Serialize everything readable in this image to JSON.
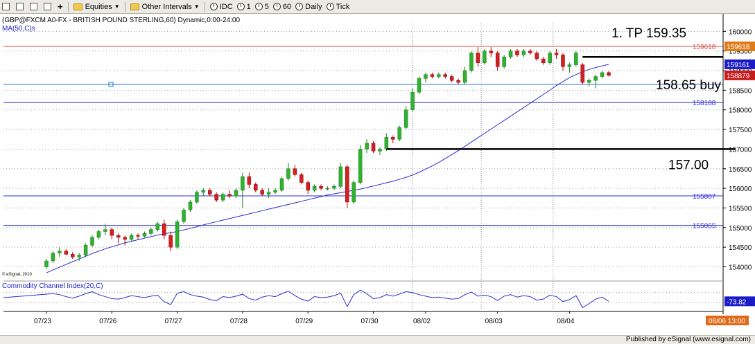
{
  "toolbar": {
    "equities": "Equities",
    "other_intervals": "Other Intervals",
    "intervals": [
      "IDC",
      "1",
      "5",
      "60",
      "Daily",
      "Tick"
    ]
  },
  "chart_data": {
    "type": "candlestick",
    "title": "(GBP@FXCM A0-FX - BRITISH POUND STERLING,60) Dynamic,0:00-24:00",
    "ma_label": "MA(50,C)s",
    "watermark": "© eSignal, 2010",
    "x_ticks": [
      "07/23",
      "07/26",
      "07/27",
      "07/28",
      "07/29",
      "07/30",
      "08/02",
      "08/03",
      "08/04"
    ],
    "y_ticks": [
      "160000",
      "159500",
      "159000",
      "158500",
      "158000",
      "157500",
      "157000",
      "156500",
      "156000",
      "155500",
      "155000",
      "154500",
      "154000"
    ],
    "ylim": [
      153850,
      160200
    ],
    "candles": [
      [
        154000,
        154200,
        153950,
        154150
      ],
      [
        154150,
        154400,
        154100,
        154350
      ],
      [
        154350,
        154500,
        154250,
        154400
      ],
      [
        154400,
        154450,
        154300,
        154320
      ],
      [
        154320,
        154380,
        154200,
        154250
      ],
      [
        154250,
        154350,
        154150,
        154300
      ],
      [
        154300,
        154600,
        154250,
        154550
      ],
      [
        154550,
        154800,
        154500,
        154750
      ],
      [
        154750,
        154950,
        154700,
        154900
      ],
      [
        154900,
        155100,
        154800,
        154950
      ],
      [
        154950,
        155000,
        154700,
        154800
      ],
      [
        154800,
        154850,
        154600,
        154750
      ],
      [
        154750,
        154800,
        154550,
        154700
      ],
      [
        154700,
        154850,
        154650,
        154800
      ],
      [
        154800,
        154850,
        154700,
        154780
      ],
      [
        154780,
        154900,
        154750,
        154850
      ],
      [
        154850,
        155000,
        154800,
        154950
      ],
      [
        154950,
        155150,
        154900,
        155100
      ],
      [
        155100,
        155200,
        154700,
        154800
      ],
      [
        154800,
        154900,
        154400,
        154500
      ],
      [
        154500,
        155200,
        154450,
        155150
      ],
      [
        155150,
        155500,
        155100,
        155450
      ],
      [
        155450,
        155700,
        155400,
        155650
      ],
      [
        155650,
        155950,
        155600,
        155900
      ],
      [
        155900,
        156000,
        155800,
        155950
      ],
      [
        155950,
        156000,
        155800,
        155850
      ],
      [
        155850,
        155900,
        155650,
        155700
      ],
      [
        155700,
        155900,
        155650,
        155850
      ],
      [
        155850,
        155950,
        155750,
        155800
      ],
      [
        155800,
        156000,
        155750,
        155950
      ],
      [
        155950,
        156400,
        155500,
        156300
      ],
      [
        156300,
        156400,
        156000,
        156100
      ],
      [
        156100,
        156150,
        155900,
        155950
      ],
      [
        155950,
        156000,
        155800,
        155850
      ],
      [
        155850,
        156000,
        155750,
        155900
      ],
      [
        155900,
        156000,
        155850,
        155950
      ],
      [
        155950,
        156300,
        155900,
        156250
      ],
      [
        156250,
        156650,
        156200,
        156500
      ],
      [
        156500,
        156600,
        156300,
        156350
      ],
      [
        156350,
        156400,
        156100,
        156150
      ],
      [
        156150,
        156200,
        155850,
        155950
      ],
      [
        155950,
        156100,
        155900,
        156050
      ],
      [
        156050,
        156100,
        155950,
        156000
      ],
      [
        156000,
        156050,
        155950,
        156000
      ],
      [
        156000,
        156100,
        155950,
        156050
      ],
      [
        156050,
        156650,
        156000,
        156550
      ],
      [
        156550,
        156600,
        155500,
        155650
      ],
      [
        155650,
        156200,
        155600,
        156150
      ],
      [
        156150,
        157100,
        156100,
        157000
      ],
      [
        157000,
        157250,
        156900,
        157150
      ],
      [
        157150,
        157200,
        156900,
        156950
      ],
      [
        156950,
        157050,
        156850,
        157000
      ],
      [
        157000,
        157400,
        156950,
        157300
      ],
      [
        157300,
        157350,
        157150,
        157250
      ],
      [
        157250,
        157600,
        157200,
        157550
      ],
      [
        157550,
        158100,
        157500,
        158000
      ],
      [
        158000,
        158550,
        157950,
        158450
      ],
      [
        158450,
        158850,
        158400,
        158800
      ],
      [
        158800,
        158950,
        158700,
        158900
      ],
      [
        158900,
        158950,
        158800,
        158850
      ],
      [
        158850,
        158950,
        158800,
        158900
      ],
      [
        158900,
        158950,
        158800,
        158850
      ],
      [
        158850,
        158900,
        158700,
        158750
      ],
      [
        158750,
        158800,
        158650,
        158700
      ],
      [
        158700,
        159100,
        158650,
        159000
      ],
      [
        159000,
        159500,
        158950,
        159450
      ],
      [
        159450,
        159600,
        159100,
        159200
      ],
      [
        159200,
        159550,
        159150,
        159500
      ],
      [
        159500,
        159600,
        159350,
        159450
      ],
      [
        159450,
        159500,
        159000,
        159100
      ],
      [
        159100,
        159400,
        159050,
        159350
      ],
      [
        159350,
        159550,
        159300,
        159500
      ],
      [
        159500,
        159550,
        159350,
        159400
      ],
      [
        159400,
        159550,
        159350,
        159500
      ],
      [
        159500,
        159550,
        159400,
        159450
      ],
      [
        159450,
        159500,
        159250,
        159300
      ],
      [
        159300,
        159350,
        159150,
        159200
      ],
      [
        159200,
        159500,
        159150,
        159450
      ],
      [
        159450,
        159550,
        159300,
        159400
      ],
      [
        159400,
        159450,
        159000,
        159100
      ],
      [
        159100,
        159200,
        158950,
        159150
      ],
      [
        159150,
        159500,
        159100,
        159450
      ],
      [
        159150,
        159200,
        158650,
        158700
      ],
      [
        158700,
        158800,
        158600,
        158750
      ],
      [
        158750,
        158900,
        158550,
        158850
      ],
      [
        158850,
        159000,
        158800,
        158950
      ],
      [
        158950,
        158980,
        158850,
        158879
      ]
    ],
    "ma_values": [
      153850,
      153920,
      153990,
      154060,
      154130,
      154200,
      154270,
      154340,
      154400,
      154460,
      154510,
      154560,
      154610,
      154650,
      154690,
      154730,
      154770,
      154810,
      154840,
      154870,
      154900,
      154940,
      154980,
      155020,
      155070,
      155110,
      155150,
      155190,
      155230,
      155270,
      155310,
      155350,
      155390,
      155430,
      155470,
      155510,
      155550,
      155590,
      155630,
      155670,
      155710,
      155750,
      155790,
      155830,
      155860,
      155890,
      155920,
      155950,
      155980,
      156020,
      156060,
      156100,
      156140,
      156180,
      156230,
      156280,
      156340,
      156410,
      156490,
      156570,
      156660,
      156760,
      156860,
      156960,
      157070,
      157180,
      157290,
      157400,
      157510,
      157620,
      157730,
      157840,
      157950,
      158060,
      158170,
      158280,
      158390,
      158500,
      158620,
      158720,
      158820,
      158900,
      158970,
      159030,
      159080,
      159120,
      159161
    ],
    "cci_values": [
      0,
      80,
      60,
      20,
      -10,
      30,
      80,
      120,
      60,
      20,
      -20,
      -30,
      0,
      40,
      20,
      0,
      30,
      50,
      -80,
      -140,
      90,
      120,
      60,
      30,
      10,
      -40,
      -60,
      20,
      0,
      30,
      70,
      -20,
      -50,
      10,
      40,
      20,
      80,
      130,
      40,
      -30,
      -70,
      20,
      0,
      10,
      40,
      90,
      -180,
      60,
      150,
      80,
      -20,
      0,
      60,
      30,
      70,
      120,
      100,
      60,
      30,
      0,
      10,
      -10,
      -30,
      -20,
      60,
      110,
      30,
      50,
      20,
      -60,
      30,
      60,
      10,
      40,
      20,
      -50,
      -30,
      50,
      20,
      -80,
      -40,
      40,
      -200,
      -120,
      -30,
      10,
      -73.82
    ],
    "cci_ylim": [
      -250,
      250
    ],
    "cci_label": "Commodity Channel Index(20,C)",
    "cci_last_label": "-73.82",
    "hlines": [
      {
        "value": 159618,
        "color": "#d9534f",
        "label": "159618"
      },
      {
        "value": 158650,
        "color": "#1a74d2",
        "label": ""
      },
      {
        "value": 158188,
        "color": "#2b2bd9",
        "label": "158188"
      },
      {
        "value": 155807,
        "color": "#2b2bd9",
        "label": "155807"
      },
      {
        "value": 155055,
        "color": "#2b2bd9",
        "label": "155055"
      }
    ],
    "price_badges": [
      {
        "value": 159618,
        "label": "159618",
        "color": "#e07b1a"
      },
      {
        "value": 159161,
        "label": "159161",
        "color": "#1b1bc8"
      },
      {
        "value": 158879,
        "label": "158879",
        "color": "#c81b1b"
      }
    ],
    "annotations": [
      {
        "text": "1. TP 159.35",
        "value": 159350
      },
      {
        "text": "158.65 buy",
        "value": 158650
      },
      {
        "text": "157.00",
        "value": 157000
      }
    ],
    "date_badge": "08/06 13:00",
    "credit": "Published by eSignal (www.esignal.com)"
  }
}
